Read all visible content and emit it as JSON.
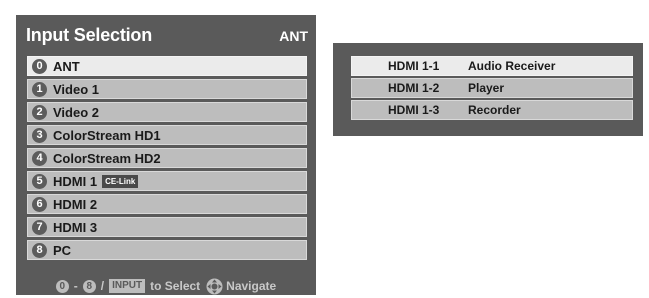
{
  "input_selection": {
    "title": "Input Selection",
    "current_input": "ANT",
    "selected_index": 0,
    "items": [
      {
        "number": "0",
        "label": "ANT",
        "badge": ""
      },
      {
        "number": "1",
        "label": "Video 1",
        "badge": ""
      },
      {
        "number": "2",
        "label": "Video 2",
        "badge": ""
      },
      {
        "number": "3",
        "label": "ColorStream HD1",
        "badge": ""
      },
      {
        "number": "4",
        "label": "ColorStream HD2",
        "badge": ""
      },
      {
        "number": "5",
        "label": "HDMI 1",
        "badge": "CE-Link"
      },
      {
        "number": "6",
        "label": "HDMI 2",
        "badge": ""
      },
      {
        "number": "7",
        "label": "HDMI 3",
        "badge": ""
      },
      {
        "number": "8",
        "label": "PC",
        "badge": ""
      }
    ],
    "footer": {
      "range_start": "0",
      "range_dash": "-",
      "range_end": "8",
      "slash": "/",
      "input_key": "INPUT",
      "select_text": "to Select",
      "navigate_text": "Navigate"
    }
  },
  "hdmi_submenu": {
    "selected_index": 0,
    "rows": [
      {
        "port": "HDMI 1-1",
        "device": "Audio Receiver"
      },
      {
        "port": "HDMI 1-2",
        "device": "Player"
      },
      {
        "port": "HDMI 1-3",
        "device": "Recorder"
      }
    ]
  },
  "colors": {
    "panel_bg": "#5a5a5a",
    "item_bg": "#bdbdbd",
    "item_selected_bg": "#ebebeb",
    "badge_bg": "#5c5c5c"
  },
  "icons": {
    "number_badge": "circled-number-icon",
    "navigate": "dpad-navigate-icon"
  }
}
